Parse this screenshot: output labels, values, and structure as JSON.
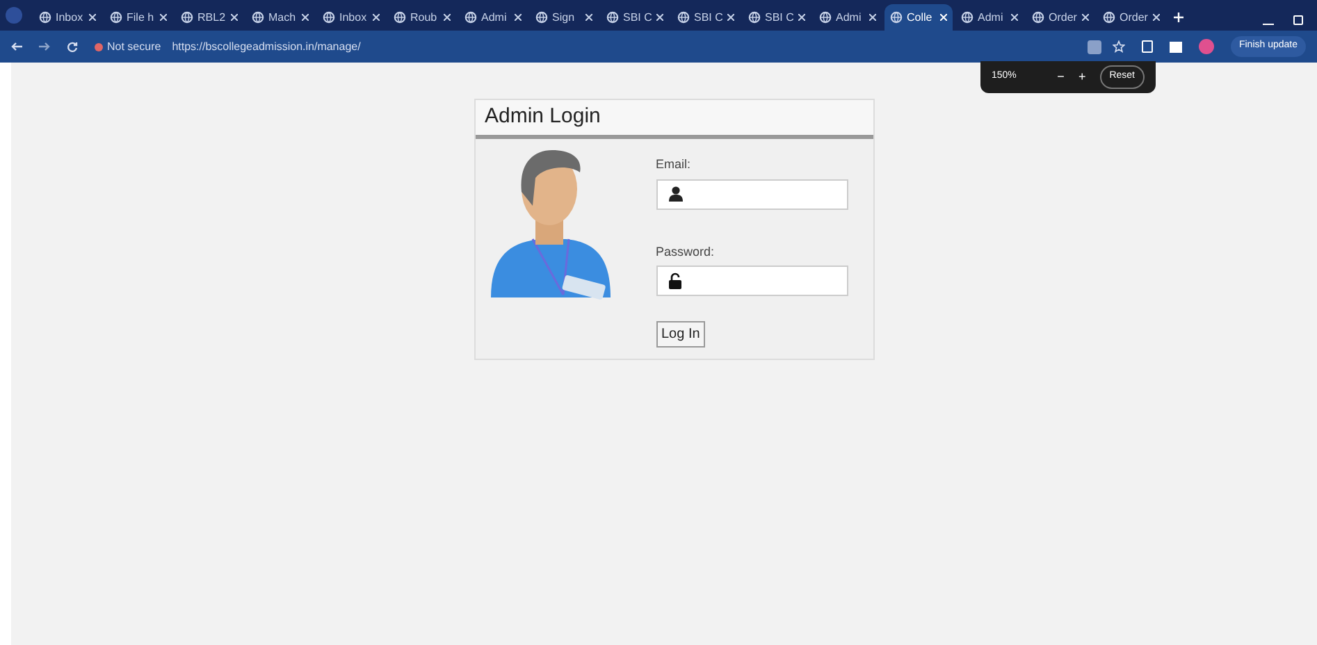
{
  "browser": {
    "tabs": [
      {
        "title": "Inbox",
        "selected": false
      },
      {
        "title": "File h",
        "selected": false
      },
      {
        "title": "RBL2",
        "selected": false
      },
      {
        "title": "Mach",
        "selected": false
      },
      {
        "title": "Inbox",
        "selected": false
      },
      {
        "title": "Roub",
        "selected": false
      },
      {
        "title": "Admi",
        "selected": false
      },
      {
        "title": "Sign",
        "selected": false
      },
      {
        "title": "SBI C",
        "selected": false
      },
      {
        "title": "SBI C",
        "selected": false
      },
      {
        "title": "SBI C",
        "selected": false
      },
      {
        "title": "Admi",
        "selected": false
      },
      {
        "title": "Colle",
        "selected": true
      },
      {
        "title": "Admi",
        "selected": false
      },
      {
        "title": "Order",
        "selected": false
      },
      {
        "title": "Order",
        "selected": false
      }
    ],
    "security": "Not secure",
    "url": "https://bscollegeadmission.in/manage/",
    "update_button": "Finish update",
    "zoom_popup": {
      "level": "150%",
      "minus": "−",
      "plus": "+",
      "reset": "Reset"
    }
  },
  "login": {
    "title": "Admin Login",
    "email_label": "Email:",
    "password_label": "Password:",
    "submit": "Log In"
  }
}
